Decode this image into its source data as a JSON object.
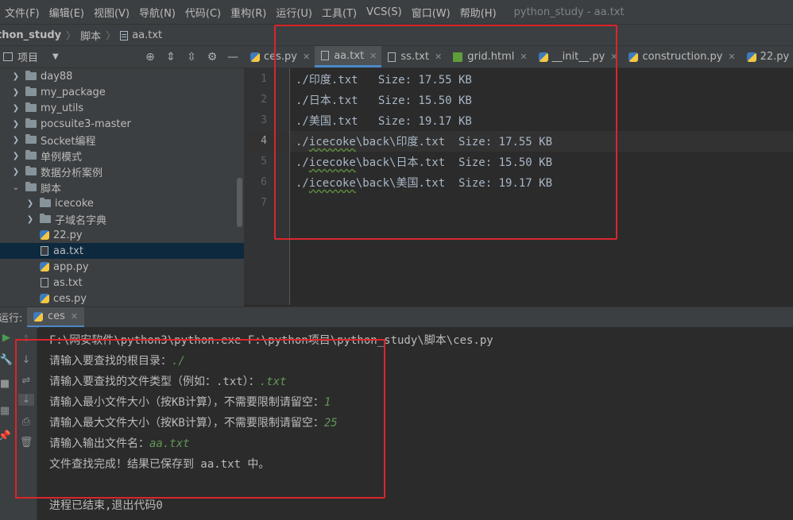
{
  "menubar": {
    "items": [
      "文件(F)",
      "编辑(E)",
      "视图(V)",
      "导航(N)",
      "代码(C)",
      "重构(R)",
      "运行(U)",
      "工具(T)",
      "VCS(S)",
      "窗口(W)",
      "帮助(H)"
    ],
    "window_title": "python_study - aa.txt"
  },
  "breadcrumb": {
    "project": "thon_study",
    "folder": "脚本",
    "file": "aa.txt"
  },
  "project_panel": {
    "title": "项目",
    "tree": [
      {
        "label": "day88",
        "kind": "folder",
        "depth": 1,
        "expanded": false
      },
      {
        "label": "my_package",
        "kind": "folder",
        "depth": 1,
        "expanded": false
      },
      {
        "label": "my_utils",
        "kind": "folder",
        "depth": 1,
        "expanded": false
      },
      {
        "label": "pocsuite3-master",
        "kind": "folder",
        "depth": 1,
        "expanded": false
      },
      {
        "label": "Socket编程",
        "kind": "folder",
        "depth": 1,
        "expanded": false
      },
      {
        "label": "单例模式",
        "kind": "folder",
        "depth": 1,
        "expanded": false
      },
      {
        "label": "数据分析案例",
        "kind": "folder",
        "depth": 1,
        "expanded": false
      },
      {
        "label": "脚本",
        "kind": "folder",
        "depth": 1,
        "expanded": true
      },
      {
        "label": "icecoke",
        "kind": "folder",
        "depth": 2,
        "expanded": false
      },
      {
        "label": "子域名字典",
        "kind": "folder",
        "depth": 2,
        "expanded": false
      },
      {
        "label": "22.py",
        "kind": "py",
        "depth": 2
      },
      {
        "label": "aa.txt",
        "kind": "txt",
        "depth": 2,
        "selected": true
      },
      {
        "label": "app.py",
        "kind": "py",
        "depth": 2
      },
      {
        "label": "as.txt",
        "kind": "txt",
        "depth": 2
      },
      {
        "label": "ces.py",
        "kind": "py",
        "depth": 2
      }
    ]
  },
  "editor": {
    "tabs": [
      {
        "label": "ces.py",
        "icon": "python-file-icon"
      },
      {
        "label": "aa.txt",
        "icon": "text-file-icon",
        "active": true
      },
      {
        "label": "ss.txt",
        "icon": "text-file-icon"
      },
      {
        "label": "grid.html",
        "icon": "html-file-icon"
      },
      {
        "label": "__init__.py",
        "icon": "python-file-icon"
      },
      {
        "label": "construction.py",
        "icon": "python-file-icon"
      },
      {
        "label": "22.py",
        "icon": "python-file-icon"
      }
    ],
    "current_line": 4,
    "lines": [
      {
        "num": "1",
        "text": "./印度.txt   Size: 17.55 KB"
      },
      {
        "num": "2",
        "text": "./日本.txt   Size: 15.50 KB"
      },
      {
        "num": "3",
        "text": "./美国.txt   Size: 19.17 KB"
      },
      {
        "num": "4",
        "prefix": "./",
        "squiggle": "icecoke",
        "rest": "\\back\\印度.txt  Size: 17.55 KB"
      },
      {
        "num": "5",
        "prefix": "./",
        "squiggle": "icecoke",
        "rest": "\\back\\日本.txt  Size: 15.50 KB"
      },
      {
        "num": "6",
        "prefix": "./",
        "squiggle": "icecoke",
        "rest": "\\back\\美国.txt  Size: 19.17 KB"
      },
      {
        "num": "7",
        "text": ""
      }
    ]
  },
  "run_panel": {
    "label": "运行:",
    "tab_label": "ces",
    "console": {
      "command": "F:\\网安软件\\python3\\python.exe F:\\python项目\\python_study\\脚本\\ces.py",
      "prompts": [
        {
          "text": "请输入要查找的根目录：",
          "input": "./"
        },
        {
          "text": "请输入要查找的文件类型（例如：.txt）：",
          "input": ".txt"
        },
        {
          "text": "请输入最小文件大小（按KB计算），不需要限制请留空：",
          "input": "1"
        },
        {
          "text": "请输入最大文件大小（按KB计算），不需要限制请留空：",
          "input": "25"
        },
        {
          "text": "请输入输出文件名：",
          "input": "aa.txt"
        }
      ],
      "result": "文件查找完成！结果已保存到 aa.txt 中。",
      "exit": "进程已结束,退出代码0"
    }
  },
  "colors": {
    "annotation_red": "#d9262c",
    "accent_blue": "#4a88c7",
    "user_input_green": "#629755"
  }
}
